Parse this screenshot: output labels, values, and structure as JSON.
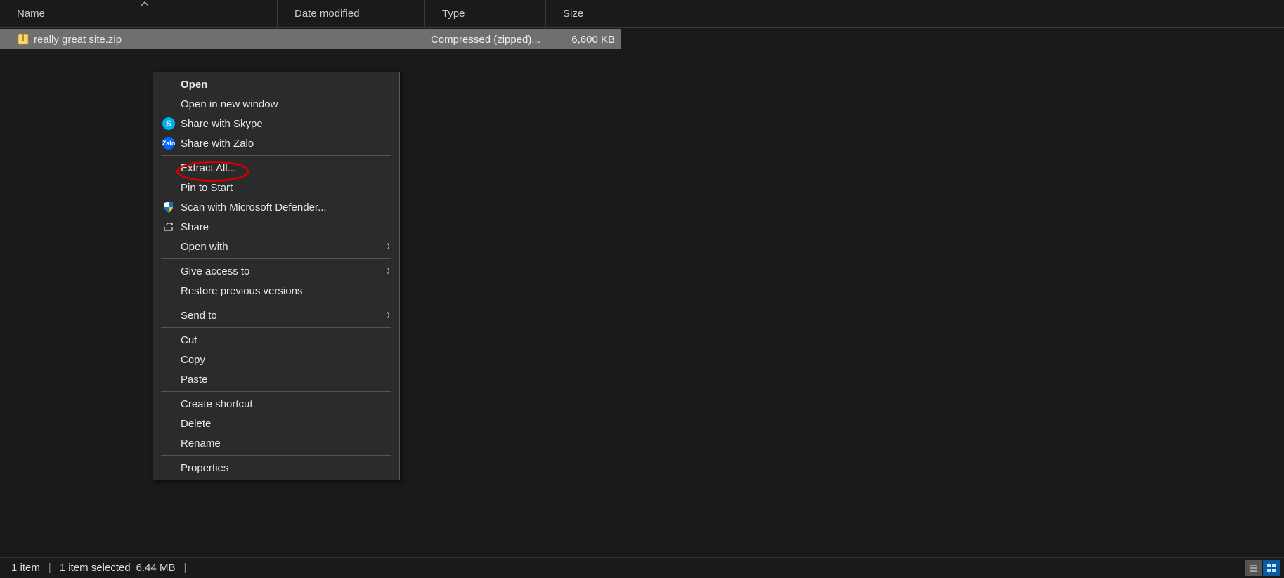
{
  "columns": {
    "name": "Name",
    "date": "Date modified",
    "type": "Type",
    "size": "Size"
  },
  "file": {
    "name": "really great site.zip",
    "date": "",
    "type": "Compressed (zipped)...",
    "size": "6,600 KB"
  },
  "context_menu": {
    "open": "Open",
    "open_new_window": "Open in new window",
    "share_skype": "Share with Skype",
    "share_zalo": "Share with Zalo",
    "extract_all": "Extract All...",
    "pin_start": "Pin to Start",
    "scan_defender": "Scan with Microsoft Defender...",
    "share": "Share",
    "open_with": "Open with",
    "give_access": "Give access to",
    "restore_versions": "Restore previous versions",
    "send_to": "Send to",
    "cut": "Cut",
    "copy": "Copy",
    "paste": "Paste",
    "create_shortcut": "Create shortcut",
    "delete": "Delete",
    "rename": "Rename",
    "properties": "Properties"
  },
  "status_bar": {
    "item_count": "1 item",
    "selection": "1 item selected",
    "size": "6.44 MB"
  }
}
